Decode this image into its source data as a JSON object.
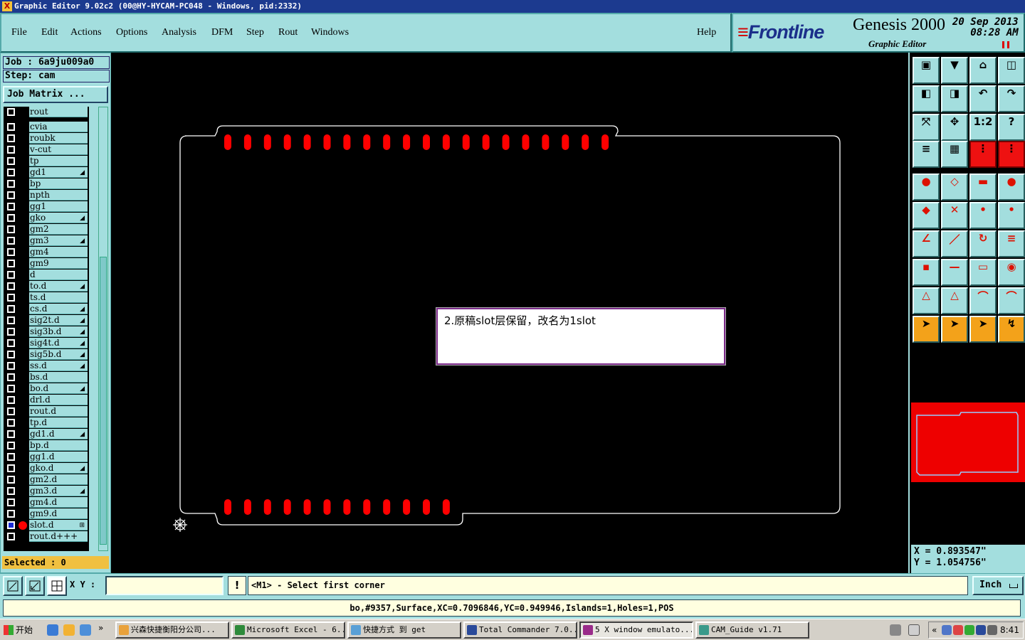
{
  "window": {
    "title": "Graphic Editor 9.02c2  (00@HY-HYCAM-PC048 - Windows, pid:2332)"
  },
  "menu": {
    "items": [
      "File",
      "Edit",
      "Actions",
      "Options",
      "Analysis",
      "DFM",
      "Step",
      "Rout",
      "Windows"
    ],
    "help": "Help"
  },
  "brand": {
    "logo": "Frontline",
    "product": "Genesis 2000",
    "subtitle": "Graphic Editor",
    "date_line1": "20 Sep 2013",
    "date_line2": "08:28 AM"
  },
  "job": {
    "job_label": "Job : 6a9ju009a0",
    "step_label": "Step: cam",
    "matrix_button": "Job Matrix ..."
  },
  "layers": [
    {
      "name": "rout",
      "flag": ""
    },
    {
      "name": "cvia",
      "flag": ""
    },
    {
      "name": "roubk",
      "flag": ""
    },
    {
      "name": "v-cut",
      "flag": ""
    },
    {
      "name": "tp",
      "flag": ""
    },
    {
      "name": "gd1",
      "flag": "◢"
    },
    {
      "name": "bp",
      "flag": ""
    },
    {
      "name": "npth",
      "flag": ""
    },
    {
      "name": "gg1",
      "flag": ""
    },
    {
      "name": "gko",
      "flag": "◢"
    },
    {
      "name": "gm2",
      "flag": ""
    },
    {
      "name": "gm3",
      "flag": "◢"
    },
    {
      "name": "gm4",
      "flag": ""
    },
    {
      "name": "gm9",
      "flag": ""
    },
    {
      "name": "d",
      "flag": ""
    },
    {
      "name": "to.d",
      "flag": "◢"
    },
    {
      "name": "ts.d",
      "flag": ""
    },
    {
      "name": "cs.d",
      "flag": "◢"
    },
    {
      "name": "sig2t.d",
      "flag": "◢"
    },
    {
      "name": "sig3b.d",
      "flag": "◢"
    },
    {
      "name": "sig4t.d",
      "flag": "◢"
    },
    {
      "name": "sig5b.d",
      "flag": "◢"
    },
    {
      "name": "ss.d",
      "flag": "◢"
    },
    {
      "name": "bs.d",
      "flag": ""
    },
    {
      "name": "bo.d",
      "flag": "◢"
    },
    {
      "name": "drl.d",
      "flag": ""
    },
    {
      "name": "rout.d",
      "flag": ""
    },
    {
      "name": "tp.d",
      "flag": ""
    },
    {
      "name": "gd1.d",
      "flag": "◢"
    },
    {
      "name": "bp.d",
      "flag": ""
    },
    {
      "name": "gg1.d",
      "flag": ""
    },
    {
      "name": "gko.d",
      "flag": "◢"
    },
    {
      "name": "gm2.d",
      "flag": ""
    },
    {
      "name": "gm3.d",
      "flag": "◢"
    },
    {
      "name": "gm4.d",
      "flag": ""
    },
    {
      "name": "gm9.d",
      "flag": ""
    },
    {
      "name": "slot.d",
      "flag": "⊞",
      "selected": true
    },
    {
      "name": "rout.d+++",
      "flag": ""
    }
  ],
  "selected_label": "Selected : 0",
  "message_box": {
    "text": "2.原稿slot层保留，改名为1slot"
  },
  "coords": {
    "x": "X = 0.893547\"",
    "y": "Y = 1.054756\""
  },
  "command": {
    "xy_label": "X Y :",
    "xy_value": "",
    "prompt": "<M1> - Select first corner",
    "unit": "Inch"
  },
  "status": {
    "text": "bo,#9357,Surface,XC=0.7096846,YC=0.949946,Islands=1,Holes=1,POS"
  },
  "taskbar": {
    "start": "开始",
    "tasks": [
      "兴森快捷衡阳分公司...",
      "Microsoft Excel - 6...",
      "快捷方式 到 get",
      "Total Commander 7.0...",
      "5 X window emulato...",
      "CAM_Guide v1.71"
    ],
    "clock": "8:41"
  }
}
